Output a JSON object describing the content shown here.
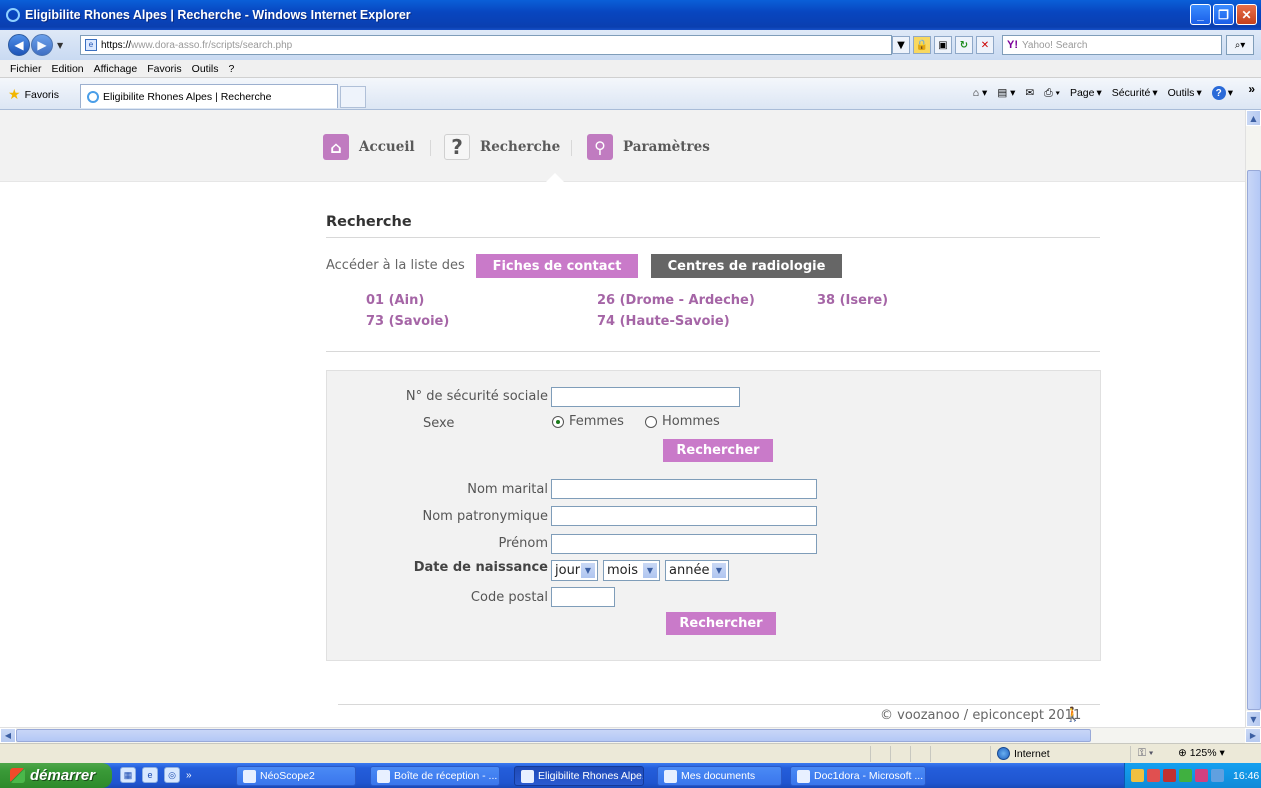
{
  "window": {
    "title": "Eligibilite Rhones Alpes | Recherche - Windows Internet Explorer"
  },
  "address": {
    "url_prefix": "https://",
    "url_host": "www.dora-asso.fr",
    "url_path": "/scripts/search.php",
    "search_placeholder": "Yahoo! Search",
    "search_logo": "Y!"
  },
  "menu": [
    "Fichier",
    "Edition",
    "Affichage",
    "Favoris",
    "Outils",
    "?"
  ],
  "favbar": {
    "favorites_label": "Favoris",
    "tab_title": "Eligibilite Rhones Alpes | Recherche",
    "page_label": "Page",
    "security_label": "Sécurité",
    "tools_label": "Outils"
  },
  "nav": {
    "home": "Accueil",
    "search": "Recherche",
    "settings": "Paramètres"
  },
  "page": {
    "heading": "Recherche",
    "access_label": "Accéder à la liste des",
    "btn_fiches": "Fiches de contact",
    "btn_centres": "Centres de radiologie",
    "departments": [
      "01 (Ain)",
      "26 (Drome - Ardeche)",
      "38 (Isere)",
      "73 (Savoie)",
      "74 (Haute-Savoie)"
    ]
  },
  "form": {
    "ssn_label": "N° de sécurité sociale",
    "ssn_value": "",
    "sex_label": "Sexe",
    "sex_female": "Femmes",
    "sex_male": "Hommes",
    "sex_selected": "Femmes",
    "search_button_1": "Rechercher",
    "marital_name_label": "Nom marital",
    "maiden_name_label": "Nom patronymique",
    "first_name_label": "Prénom",
    "dob_label": "Date de naissance",
    "day_value": "jour",
    "month_value": "mois",
    "year_value": "année",
    "postal_label": "Code postal",
    "search_button_2": "Rechercher"
  },
  "footer": {
    "text": "© voozanoo / epiconcept 2011"
  },
  "status": {
    "zone": "Internet",
    "zoom": "125%"
  },
  "taskbar": {
    "start": "démarrer",
    "items": [
      "NéoScope2",
      "Boîte de réception - ...",
      "Eligibilite Rhones Alpe...",
      "Mes documents",
      "Doc1dora - Microsoft ..."
    ],
    "clock": "16:46"
  },
  "colors": {
    "accent_pink": "#c97ac9",
    "dept_link": "#a565a6",
    "dark_button": "#666666"
  }
}
